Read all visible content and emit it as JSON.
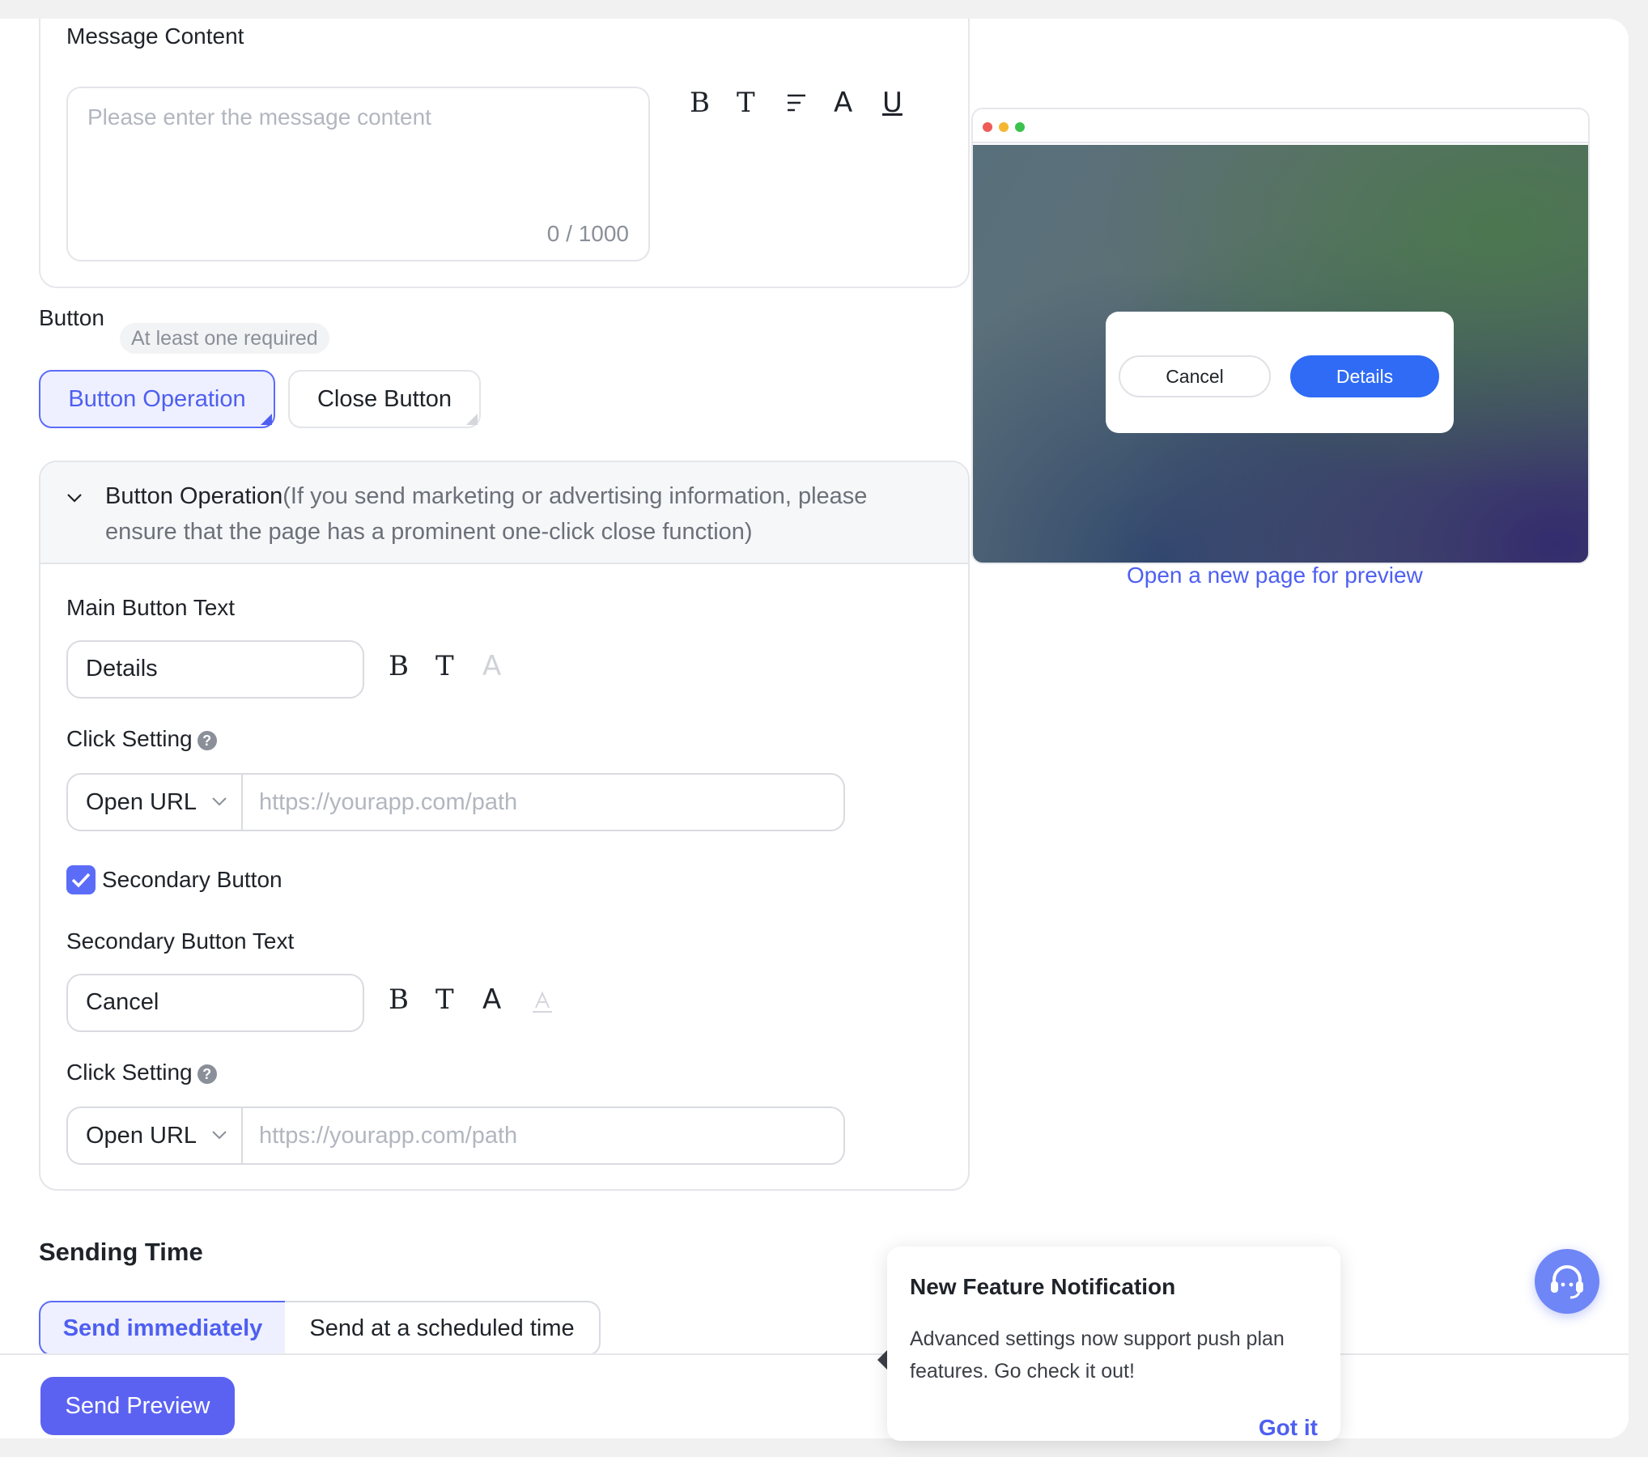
{
  "message": {
    "label": "Message Content",
    "placeholder": "Please enter the message content",
    "counter": "0 / 1000",
    "toolbar": [
      "B",
      "T",
      "≡",
      "A",
      "U"
    ]
  },
  "buttons": {
    "label": "Button",
    "hint": "At least one required",
    "tabs": [
      "Button Operation",
      "Close Button"
    ]
  },
  "panel": {
    "title": "Button Operation",
    "title_note_line1": "(If you send marketing or advertising information, please",
    "title_note_line2": "ensure that the page has a prominent one-click close function)",
    "main_label": "Main Button Text",
    "main_value": "Details",
    "click_label": "Click Setting",
    "click_action": "Open URL",
    "url_placeholder": "https://yourapp.com/path",
    "secondary_checkbox": "Secondary Button",
    "secondary_checked": true,
    "secondary_label": "Secondary Button Text",
    "secondary_value": "Cancel",
    "click_label2": "Click Setting",
    "click_action2": "Open URL",
    "url_placeholder2": "https://yourapp.com/path"
  },
  "preview": {
    "cancel": "Cancel",
    "details": "Details",
    "open_link": "Open a new page for preview"
  },
  "sending": {
    "title": "Sending Time",
    "options": [
      "Send immediately",
      "Send at a scheduled time"
    ]
  },
  "footer": {
    "send_preview": "Send Preview"
  },
  "popover": {
    "title": "New Feature Notification",
    "body": "Advanced settings now support push plan features. Go check it out!",
    "action": "Got it"
  },
  "colors": {
    "accent": "#5b6cf9",
    "preview_primary": "#2f6bf5"
  }
}
